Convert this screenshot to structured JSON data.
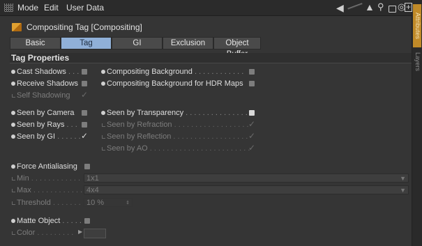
{
  "menubar": {
    "items": [
      "Mode",
      "Edit",
      "User Data"
    ]
  },
  "toolbar": {
    "icons": [
      "back-arrow-icon",
      "up-arrow-icon",
      "search-icon",
      "lock-icon",
      "target-icon",
      "new-panel-icon"
    ]
  },
  "title": "Compositing Tag [Compositing]",
  "tabs": [
    {
      "label": "Basic",
      "active": false
    },
    {
      "label": "Tag",
      "active": true
    },
    {
      "label": "GI",
      "active": false
    },
    {
      "label": "Exclusion",
      "active": false
    },
    {
      "label": "Object Buffer",
      "active": false
    }
  ],
  "section_title": "Tag Properties",
  "props": {
    "cast_shadows": {
      "label": "Cast Shadows",
      "dots": " . . . ",
      "checked": false
    },
    "receive_shadows": {
      "label": "Receive Shadows",
      "dots": " ",
      "checked": false
    },
    "self_shadowing": {
      "label": "Self Shadowing",
      "dots": " ",
      "checked": true,
      "enabled": false
    },
    "comp_bg": {
      "label": "Compositing Background",
      "dots": " . . . . . . . . . . . .",
      "checked": false
    },
    "comp_bg_hdr": {
      "label": "Compositing Background for HDR Maps",
      "dots": " ",
      "checked": false
    },
    "seen_camera": {
      "label": "Seen by Camera",
      "dots": " ",
      "checked": false
    },
    "seen_rays": {
      "label": "Seen by Rays",
      "dots": " . . . ",
      "checked": false
    },
    "seen_gi": {
      "label": "Seen by GI",
      "dots": " . . . . . . ",
      "checked": true
    },
    "seen_transparency": {
      "label": "Seen by Transparency",
      "dots": " . . . . . . . . . . . . . . .",
      "checked": false
    },
    "seen_refraction": {
      "label": "Seen by Refraction",
      "dots": " . . . . . . . . . . . . . . . . . .",
      "checked": true,
      "enabled": false
    },
    "seen_reflection": {
      "label": "Seen by Reflection",
      "dots": " . . . . . . . . . . . . . . . . . .",
      "checked": true,
      "enabled": false
    },
    "seen_ao": {
      "label": "Seen by AO",
      "dots": " . . . . . . . . . . . . . . . . . . . . . . . .",
      "checked": true,
      "enabled": false
    },
    "force_aa": {
      "label": "Force Antialiasing",
      "dots": " ",
      "checked": false
    },
    "aa_min": {
      "label": "Min",
      "dots": " . . . . . . . . . . . . ",
      "value": "1x1",
      "enabled": false
    },
    "aa_max": {
      "label": "Max",
      "dots": " . . . . . . . . . . . . ",
      "value": "4x4",
      "enabled": false
    },
    "aa_threshold": {
      "label": "Threshold",
      "dots": " . . . . . . . ",
      "value": "10 %",
      "enabled": false
    },
    "matte_object": {
      "label": "Matte Object",
      "dots": " . . . . . ",
      "checked": false
    },
    "matte_color": {
      "label": "Color",
      "dots": " . . . . . . . . . ",
      "enabled": false
    }
  },
  "sidebar": {
    "tabs": [
      "Attributes",
      "Layers"
    ]
  },
  "colors": {
    "accent": "#90b0d8",
    "sidebar_active": "#c08a28"
  }
}
